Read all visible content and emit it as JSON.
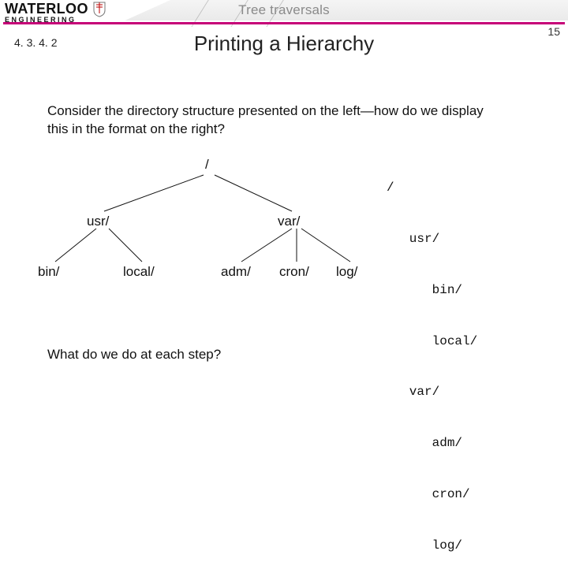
{
  "header": {
    "topic": "Tree traversals",
    "logo_word_top": "WATERLOO",
    "logo_word_bottom": "ENGINEERING",
    "page_number": "15",
    "section_number": "4. 3. 4. 2",
    "title": "Printing a Hierarchy"
  },
  "body": {
    "paragraph": "Consider the directory structure presented on the left—how do we display this in the format on the right?",
    "question": "What do we do at each step?"
  },
  "tree": {
    "root": "/",
    "left": {
      "label": "usr/",
      "children": [
        "bin/",
        "local/"
      ]
    },
    "right": {
      "label": "var/",
      "children": [
        "adm/",
        "cron/",
        "log/"
      ]
    }
  },
  "listing": {
    "lines": [
      "/",
      "   usr/",
      "      bin/",
      "      local/",
      "   var/",
      "      adm/",
      "      cron/",
      "      log/"
    ]
  }
}
